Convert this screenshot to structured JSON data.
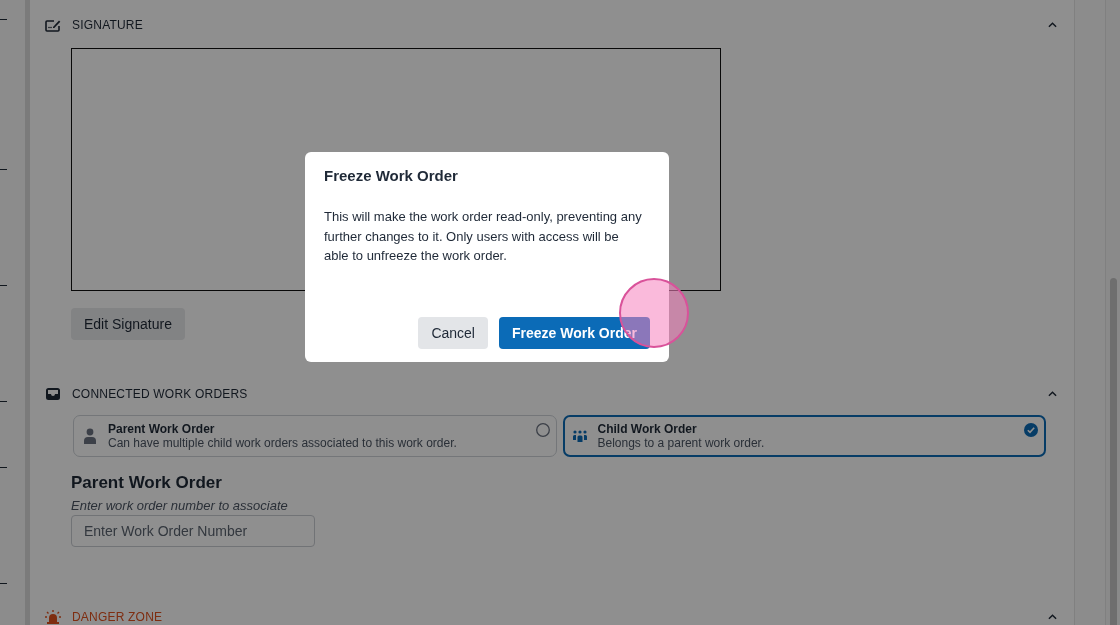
{
  "sections": [
    {
      "kind": "signature",
      "title": "SIGNATURE",
      "expanded": true,
      "edit_button": "Edit Signature"
    },
    {
      "kind": "connected",
      "title": "CONNECTED WORK ORDERS",
      "expanded": true,
      "options": [
        {
          "kind": "parent",
          "title": "Parent Work Order",
          "description": "Can have multiple child work orders associated to this work order.",
          "selected": false
        },
        {
          "kind": "child",
          "title": "Child Work Order",
          "description": "Belongs to a parent work order.",
          "selected": true
        }
      ],
      "field": {
        "heading": "Parent Work Order",
        "hint": "Enter work order number to associate",
        "placeholder": "Enter Work Order Number"
      }
    },
    {
      "kind": "danger",
      "title": "DANGER ZONE",
      "expanded": true
    }
  ],
  "dialog": {
    "title": "Freeze Work Order",
    "message": "This will make the work order read-only, preventing any further changes to it. Only users with access will be able to unfreeze the work order.",
    "buttons": [
      {
        "kind": "secondary",
        "label": "Cancel"
      },
      {
        "kind": "primary",
        "label": "Freeze Work Order"
      }
    ]
  }
}
